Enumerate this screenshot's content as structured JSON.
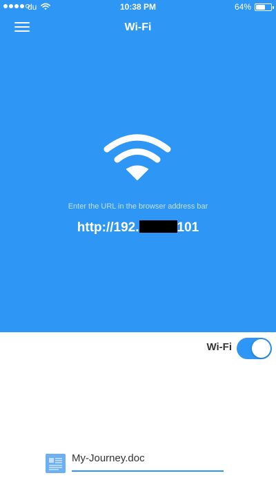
{
  "status_bar": {
    "carrier": "du",
    "time": "10:38 PM",
    "battery_text": "64%",
    "battery_level": 0.64,
    "signal_bars_filled": 4,
    "signal_bars_total": 5
  },
  "nav": {
    "title": "Wi-Fi",
    "menu_icon": "hamburger-menu-icon"
  },
  "hero": {
    "icon": "wifi-icon",
    "hint": "Enter the URL in the browser address bar",
    "url_prefix": "http://192.",
    "url_suffix": "101",
    "background_color": "#2e96f4"
  },
  "wifi_toggle": {
    "label": "Wi-Fi",
    "on": true,
    "accent_color": "#2e96f4"
  },
  "file": {
    "icon": "document-icon",
    "name": "My-Journey.doc"
  }
}
